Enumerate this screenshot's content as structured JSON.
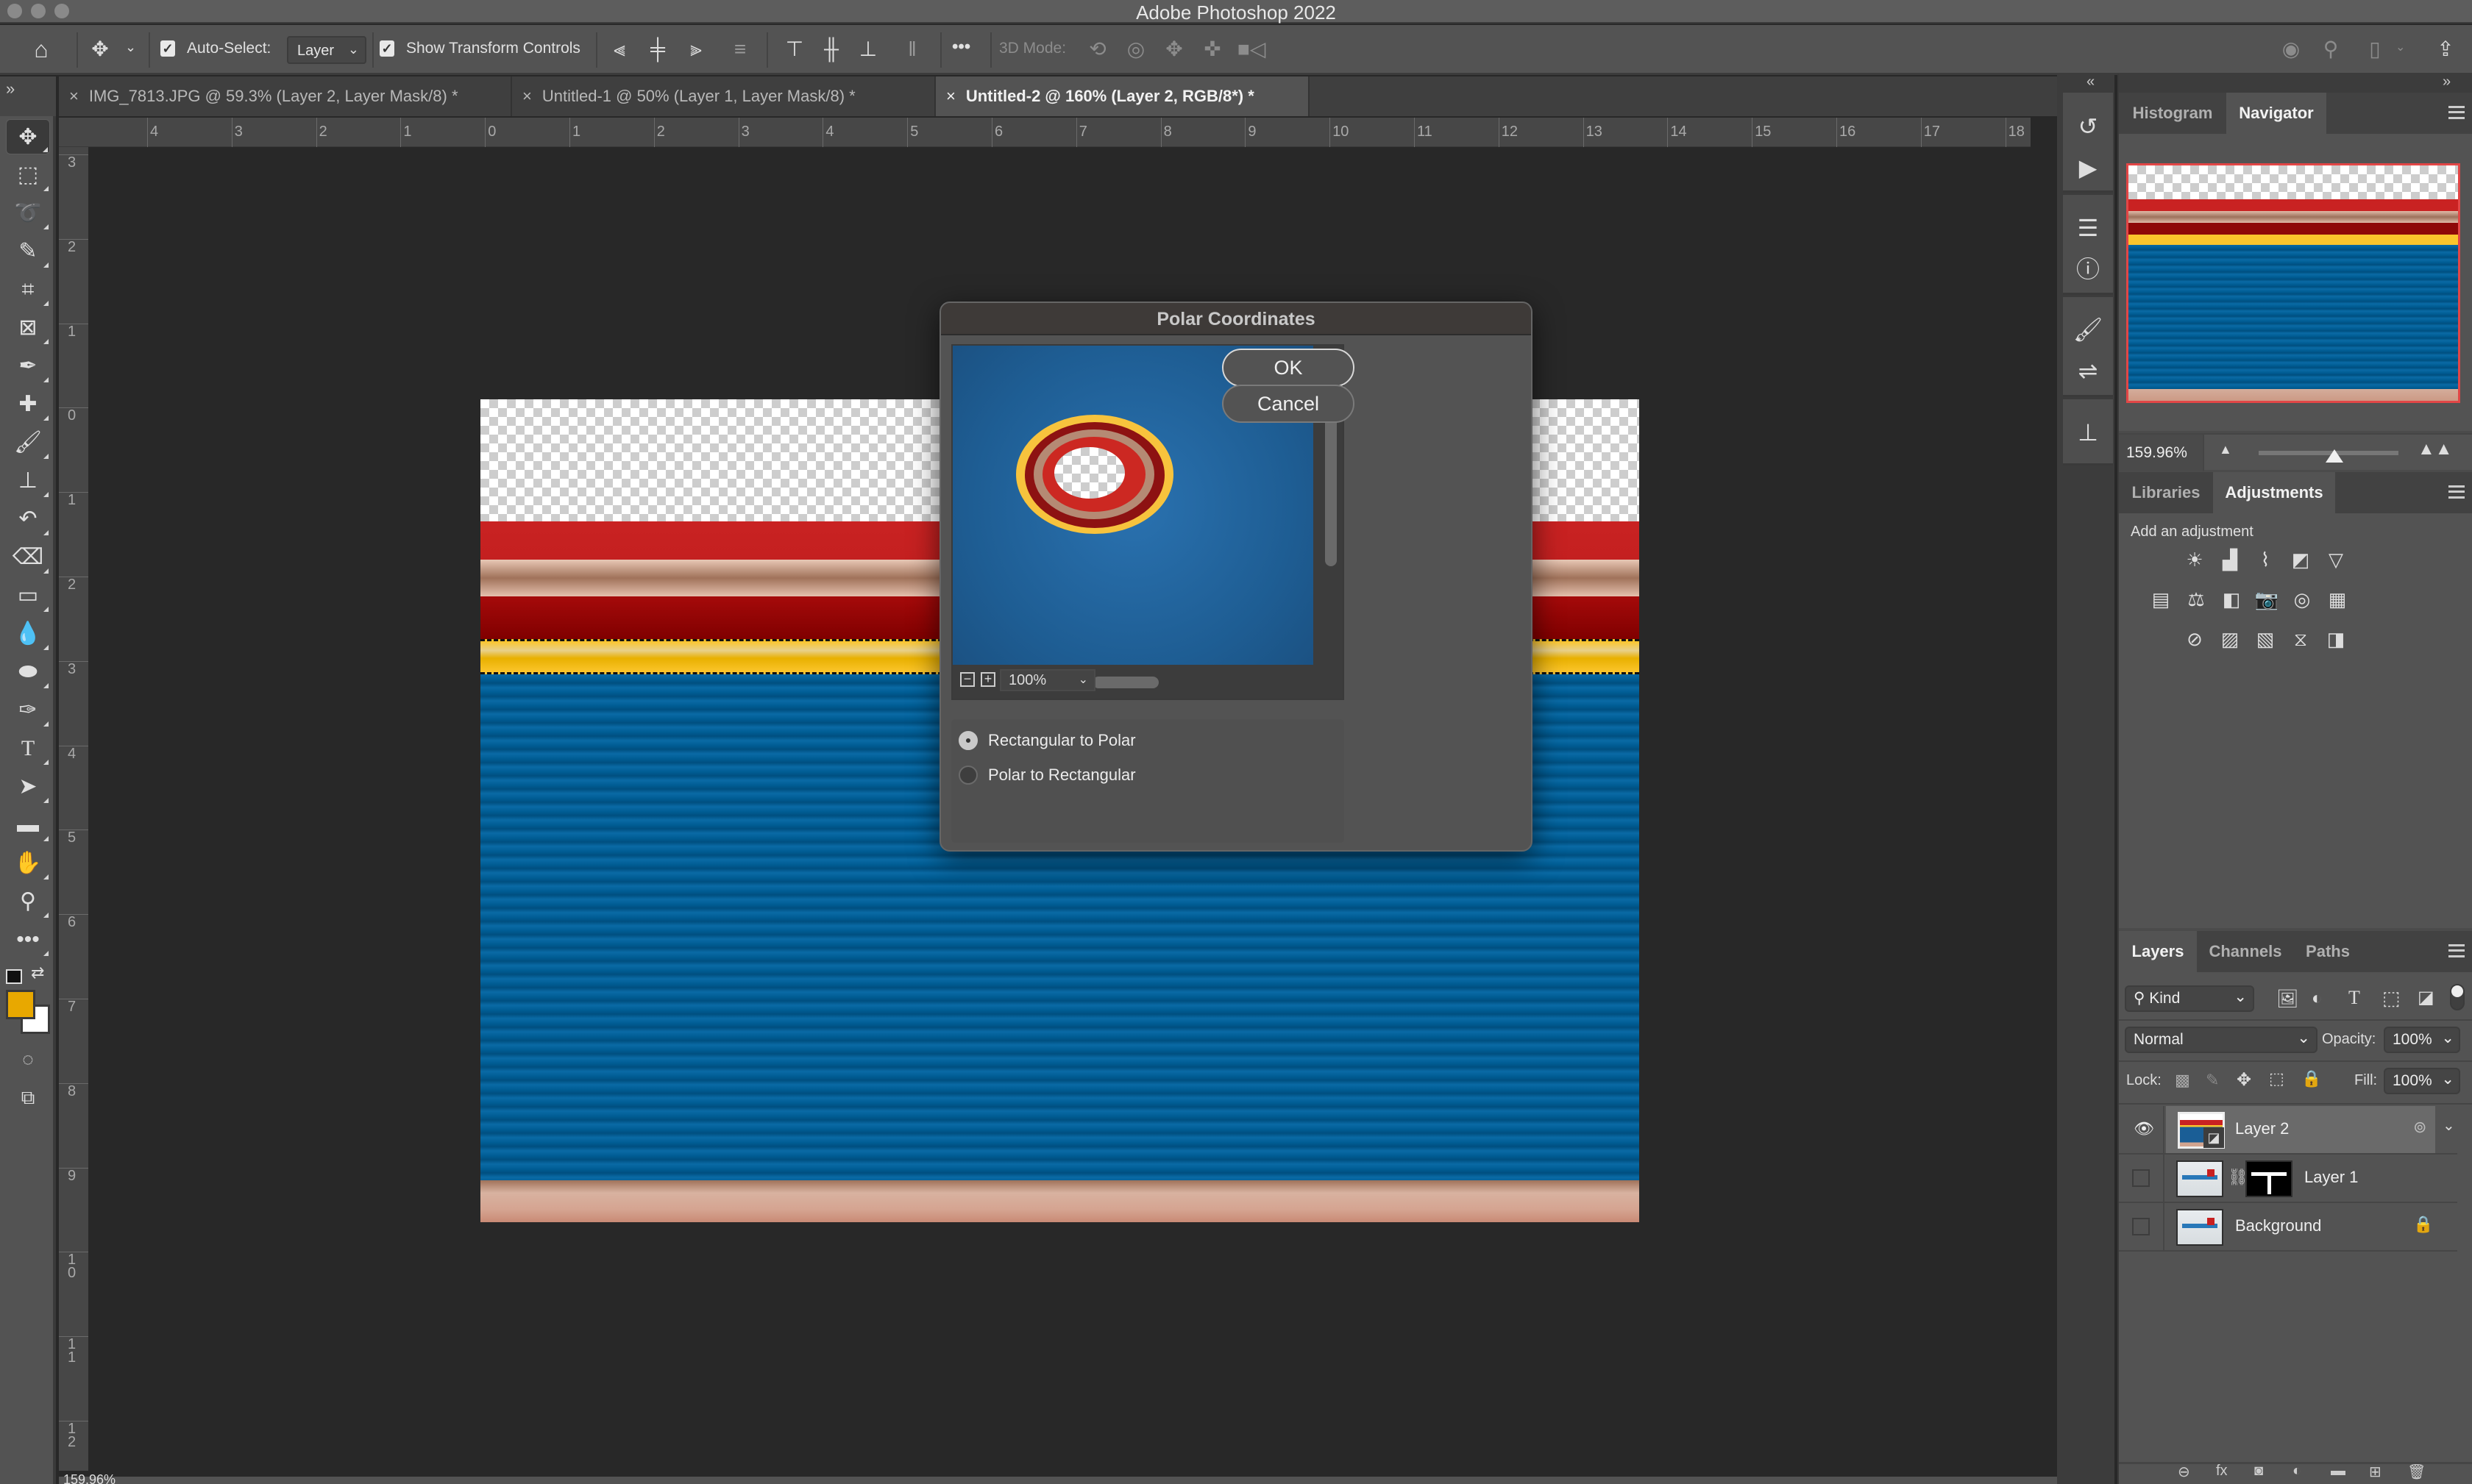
{
  "app": {
    "title": "Adobe Photoshop 2022"
  },
  "options_bar": {
    "auto_select_label": "Auto-Select:",
    "auto_select_checked": true,
    "auto_select_target": "Layer",
    "show_transform_label": "Show Transform Controls",
    "show_transform_checked": true,
    "more_label": "•••",
    "mode_3d_label": "3D Mode:"
  },
  "tabs": [
    {
      "label": "IMG_7813.JPG @ 59.3% (Layer 2, Layer Mask/8) *",
      "active": false
    },
    {
      "label": "Untitled-1 @ 50% (Layer 1, Layer Mask/8) *",
      "active": false
    },
    {
      "label": "Untitled-2 @ 160% (Layer 2, RGB/8*) *",
      "active": true
    }
  ],
  "tab_close_glyph": "×",
  "rulers": {
    "horizontal": [
      "4",
      "3",
      "2",
      "1",
      "0",
      "1",
      "2",
      "3",
      "4",
      "5",
      "6",
      "7",
      "8",
      "9",
      "10",
      "11",
      "12",
      "13",
      "14",
      "15",
      "16",
      "17",
      "18"
    ],
    "vertical": [
      "3",
      "2",
      "1",
      "0",
      "1",
      "2",
      "3",
      "4",
      "5",
      "6",
      "7",
      "8",
      "9",
      "1 0",
      "1 1",
      "1 2"
    ]
  },
  "toolbar": {
    "tools": [
      {
        "name": "move-tool",
        "glyph": "✥"
      },
      {
        "name": "rectangular-marquee-tool",
        "glyph": "⬚"
      },
      {
        "name": "lasso-tool",
        "glyph": "➰"
      },
      {
        "name": "quick-selection-tool",
        "glyph": "✎"
      },
      {
        "name": "crop-tool",
        "glyph": "⌗"
      },
      {
        "name": "frame-tool",
        "glyph": "⊠"
      },
      {
        "name": "eyedropper-tool",
        "glyph": "✒"
      },
      {
        "name": "healing-brush-tool",
        "glyph": "✚"
      },
      {
        "name": "brush-tool",
        "glyph": "🖌"
      },
      {
        "name": "clone-stamp-tool",
        "glyph": "⊥"
      },
      {
        "name": "history-brush-tool",
        "glyph": "↶"
      },
      {
        "name": "eraser-tool",
        "glyph": "⌫"
      },
      {
        "name": "gradient-tool",
        "glyph": "▭"
      },
      {
        "name": "blur-tool",
        "glyph": "💧"
      },
      {
        "name": "sponge-tool",
        "glyph": "⬬"
      },
      {
        "name": "pen-tool",
        "glyph": "✑"
      },
      {
        "name": "type-tool",
        "glyph": "T"
      },
      {
        "name": "path-selection-tool",
        "glyph": "➤"
      },
      {
        "name": "rectangle-tool",
        "glyph": "▬"
      },
      {
        "name": "hand-tool",
        "glyph": "✋"
      },
      {
        "name": "zoom-tool",
        "glyph": "⚲"
      },
      {
        "name": "edit-toolbar",
        "glyph": "•••"
      }
    ],
    "foreground_color": "#e8a800",
    "background_color": "#ffffff"
  },
  "dialog": {
    "title": "Polar Coordinates",
    "ok_label": "OK",
    "cancel_label": "Cancel",
    "zoom_value": "100%",
    "zoom_out_glyph": "−",
    "zoom_in_glyph": "+",
    "options": [
      {
        "label": "Rectangular to Polar",
        "selected": true
      },
      {
        "label": "Polar to Rectangular",
        "selected": false
      }
    ]
  },
  "navigator": {
    "tabs": [
      {
        "label": "Histogram",
        "active": false
      },
      {
        "label": "Navigator",
        "active": true
      }
    ],
    "zoom_value": "159.96%",
    "zoom_slider_fraction": 0.54
  },
  "adjustments": {
    "tabs": [
      {
        "label": "Libraries",
        "active": false
      },
      {
        "label": "Adjustments",
        "active": true
      }
    ],
    "heading": "Add an adjustment",
    "rows": [
      [
        {
          "name": "brightness-contrast-icon",
          "glyph": "☀"
        },
        {
          "name": "levels-icon",
          "glyph": "▟"
        },
        {
          "name": "curves-icon",
          "glyph": "⌇"
        },
        {
          "name": "exposure-icon",
          "glyph": "◩"
        },
        {
          "name": "vibrance-icon",
          "glyph": "▽"
        }
      ],
      [
        {
          "name": "hue-saturation-icon",
          "glyph": "▤"
        },
        {
          "name": "color-balance-icon",
          "glyph": "⚖"
        },
        {
          "name": "black-white-icon",
          "glyph": "◧"
        },
        {
          "name": "photo-filter-icon",
          "glyph": "📷"
        },
        {
          "name": "channel-mixer-icon",
          "glyph": "◎"
        },
        {
          "name": "color-lookup-icon",
          "glyph": "▦"
        }
      ],
      [
        {
          "name": "invert-icon",
          "glyph": "⊘"
        },
        {
          "name": "posterize-icon",
          "glyph": "▨"
        },
        {
          "name": "threshold-icon",
          "glyph": "▧"
        },
        {
          "name": "selective-color-icon",
          "glyph": "⧖"
        },
        {
          "name": "gradient-map-icon",
          "glyph": "◨"
        }
      ]
    ]
  },
  "layers_panel": {
    "tabs": [
      {
        "label": "Layers",
        "active": true
      },
      {
        "label": "Channels",
        "active": false
      },
      {
        "label": "Paths",
        "active": false
      }
    ],
    "filter_kind": "Kind",
    "blend_mode": "Normal",
    "opacity_label": "Opacity:",
    "opacity_value": "100%",
    "lock_label": "Lock:",
    "fill_label": "Fill:",
    "fill_value": "100%",
    "layers": [
      {
        "name": "Layer 2",
        "visible": true,
        "selected": true,
        "smart_object": true,
        "has_mask": false,
        "locked": false
      },
      {
        "name": "Layer 1",
        "visible": false,
        "selected": false,
        "smart_object": false,
        "has_mask": true,
        "locked": false
      },
      {
        "name": "Background",
        "visible": false,
        "selected": false,
        "smart_object": false,
        "has_mask": false,
        "locked": true
      }
    ],
    "footer_icons": [
      "link-layers-icon",
      "fx-icon",
      "add-mask-icon",
      "adjustment-layer-icon",
      "new-group-icon",
      "new-layer-icon",
      "delete-layer-icon"
    ],
    "footer_glyphs": [
      "⊖",
      "fx",
      "◙",
      "◐",
      "▬",
      "⊞",
      "🗑"
    ]
  },
  "status_bar": {
    "zoom": "159.96%"
  }
}
